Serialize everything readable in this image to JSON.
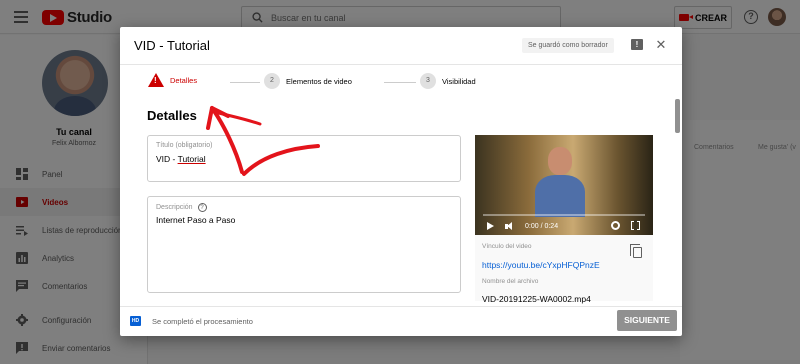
{
  "topbar": {
    "logo_text": "Studio",
    "search_placeholder": "Buscar en tu canal",
    "create_label": "CREAR",
    "help_symbol": "?"
  },
  "sidebar": {
    "channel_title": "Tu canal",
    "channel_name": "Felix Albornoz",
    "items": [
      {
        "label": "Panel",
        "icon": "dashboard-icon",
        "active": false
      },
      {
        "label": "Videos",
        "icon": "videos-icon",
        "active": true
      },
      {
        "label": "Listas de reproducción",
        "icon": "playlists-icon",
        "active": false
      },
      {
        "label": "Analytics",
        "icon": "analytics-icon",
        "active": false
      },
      {
        "label": "Comentarios",
        "icon": "comments-icon",
        "active": false
      },
      {
        "label": "Configuración",
        "icon": "gear-icon",
        "active": false
      },
      {
        "label": "Enviar comentarios",
        "icon": "feedback-icon",
        "active": false
      }
    ]
  },
  "background": {
    "col_comments": "Comentarios",
    "col_likes": "Me gusta' (v"
  },
  "dialog": {
    "title": "VID - Tutorial",
    "draft_status": "Se guardó como borrador",
    "steps": [
      {
        "number": "",
        "label": "Detalles",
        "state": "error"
      },
      {
        "number": "2",
        "label": "Elementos de video",
        "state": "pending"
      },
      {
        "number": "3",
        "label": "Visibilidad",
        "state": "pending"
      }
    ],
    "section_title": "Detalles",
    "title_field": {
      "label": "Título (obligatorio)",
      "value_prefix": "VID - ",
      "value_underlined": "Tutorial"
    },
    "description_field": {
      "label": "Descripción",
      "value": "Internet Paso a Paso"
    },
    "video": {
      "time": "0:00 / 0:24",
      "progress": 0,
      "link_label": "Vínculo del video",
      "link_url": "https://youtu.be/cYxpHFQPnzE",
      "filename_label": "Nombre del archivo",
      "filename": "VID-20191225-WA0002.mp4"
    },
    "footer": {
      "hd_badge": "HD",
      "processing_status": "Se completó el procesamiento",
      "next_label": "SIGUIENTE"
    }
  },
  "colors": {
    "accent_red": "#cc0000",
    "link_blue": "#065fd4",
    "annotation_red": "#e3141b"
  }
}
